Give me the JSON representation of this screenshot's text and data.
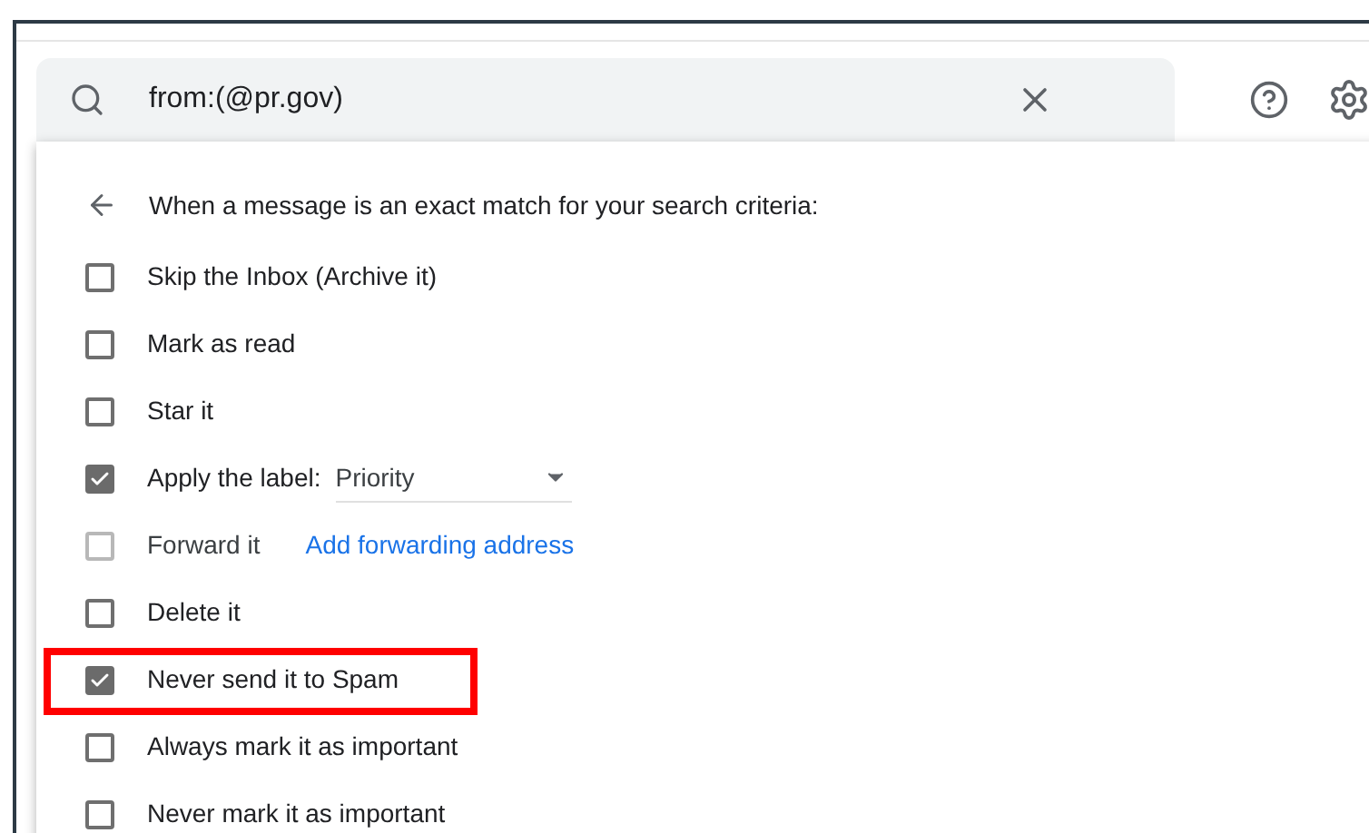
{
  "search": {
    "value": "from:(@pr.gov)"
  },
  "panel": {
    "heading": "When a message is an exact match for your search criteria:",
    "actions": [
      {
        "kind": "checkbox",
        "label": "Skip the Inbox (Archive it)",
        "checked": false,
        "disabled": false,
        "highlighted": false
      },
      {
        "kind": "checkbox",
        "label": "Mark as read",
        "checked": false,
        "disabled": false,
        "highlighted": false
      },
      {
        "kind": "checkbox",
        "label": "Star it",
        "checked": false,
        "disabled": false,
        "highlighted": false
      },
      {
        "kind": "select",
        "label": "Apply the label:",
        "value": "Priority",
        "checked": true,
        "disabled": false,
        "highlighted": false
      },
      {
        "kind": "link",
        "label": "Forward it",
        "link": "Add forwarding address",
        "checked": false,
        "disabled": true,
        "highlighted": false
      },
      {
        "kind": "checkbox",
        "label": "Delete it",
        "checked": false,
        "disabled": false,
        "highlighted": false
      },
      {
        "kind": "checkbox",
        "label": "Never send it to Spam",
        "checked": true,
        "disabled": false,
        "highlighted": true
      },
      {
        "kind": "checkbox",
        "label": "Always mark it as important",
        "checked": false,
        "disabled": false,
        "highlighted": false
      },
      {
        "kind": "checkbox",
        "label": "Never mark it as important",
        "checked": false,
        "disabled": false,
        "highlighted": false
      }
    ]
  }
}
